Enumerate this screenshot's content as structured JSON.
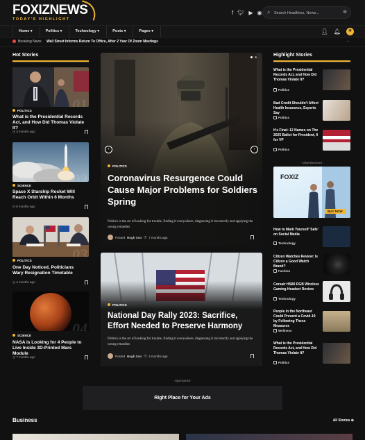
{
  "brand": {
    "logo": "FOXIZNEWS",
    "tagline": "TODAY'S HIGHLIGHT",
    "accent": "#f2b632"
  },
  "header": {
    "social_icons": [
      "facebook-icon",
      "twitter-icon",
      "youtube-icon",
      "rss-icon"
    ],
    "search_placeholder": "Search Headlines, News..."
  },
  "nav": {
    "items": [
      {
        "label": "Home ▾"
      },
      {
        "label": "Politics ▾"
      },
      {
        "label": "Technology ▾"
      },
      {
        "label": "Posts ▾"
      },
      {
        "label": "Pages ▾"
      }
    ]
  },
  "ticker": {
    "label": "Breaking News",
    "headline": "Wall Street Informs Return To Office, After 2 Year Of Zoom Meetings"
  },
  "hot_stories": {
    "title": "Hot Stories",
    "items": [
      {
        "category": "POLITICS",
        "title": "What is the Presidential Records Act, and How Did Thomas Violate It?",
        "date": "3 months ago",
        "num": "01"
      },
      {
        "category": "SCIENCE",
        "title": "Space X Starship Rocket Will Reach Orbit Within 6 Months",
        "date": "8 months ago",
        "num": "02"
      },
      {
        "category": "POLITICS",
        "title": "One Day Noticed, Politicians Wary Resignation Timetable",
        "date": "4 months ago",
        "num": "03"
      },
      {
        "category": "SCIENCE",
        "title": "NASA is Looking for 4 People to Live Inside 3D-Printed Mars Module",
        "date": "7 months ago",
        "num": "04"
      }
    ]
  },
  "hero": [
    {
      "category": "POLITICS",
      "title": "Coronavirus Resurgence Could Cause Major Problems for Soldiers Spring",
      "excerpt": "Politics is the art of looking for trouble, finding it everywhere, diagnosing it incorrectly and applying the wrong remedies",
      "posted": "Posted",
      "author": "Hugh Son",
      "date": "7 months ago"
    },
    {
      "category": "POLITICS",
      "title": "National Day Rally 2023: Sacrifice, Effort Needed to Preserve Harmony",
      "excerpt": "Politics is the art of looking for trouble, finding it everywhere, diagnosing it incorrectly and applying the wrong remedies",
      "posted": "Posted",
      "author": "Hugh Son",
      "date": "4 months ago"
    }
  ],
  "highlight": {
    "title": "Highlight Stories",
    "top": [
      {
        "title": "What is the Presidential Records Act, and How Did Thomas Violate It?",
        "category": "Politics"
      },
      {
        "title": "Bad Credit Shouldn't Affect Health Insurance, Experts Say",
        "category": "Politics"
      },
      {
        "title": "It's Final: 12 Names on The 2025 Ballot for President, 9 for VP",
        "category": "Politics"
      }
    ],
    "bottom": [
      {
        "title": "How to Mark Yourself 'Safe' on Social Media",
        "category": "Technology"
      },
      {
        "title": "Citizen Watches Review: Is Citizen a Good Watch Brand?",
        "category": "Fashion"
      },
      {
        "title": "Corsair HS80 RGB Wireless Gaming Headset Review",
        "category": "Technology"
      },
      {
        "title": "People in the Northeast Could Prevent a Covid-19 by Following These Measures",
        "category": "Wellness"
      },
      {
        "title": "What is the Presidential Records Act, and How Did Thomas Violate It?",
        "category": "Politics"
      }
    ]
  },
  "advert": {
    "label": "- Advertisement -",
    "brand": "FOXIZ",
    "cta": "BUY NOW"
  },
  "sponsored": {
    "label": "- Sponsored -",
    "banner_text": "Right Place for Your Ads"
  },
  "business": {
    "title": "Business",
    "all_stories": "All Stories ⊕"
  }
}
